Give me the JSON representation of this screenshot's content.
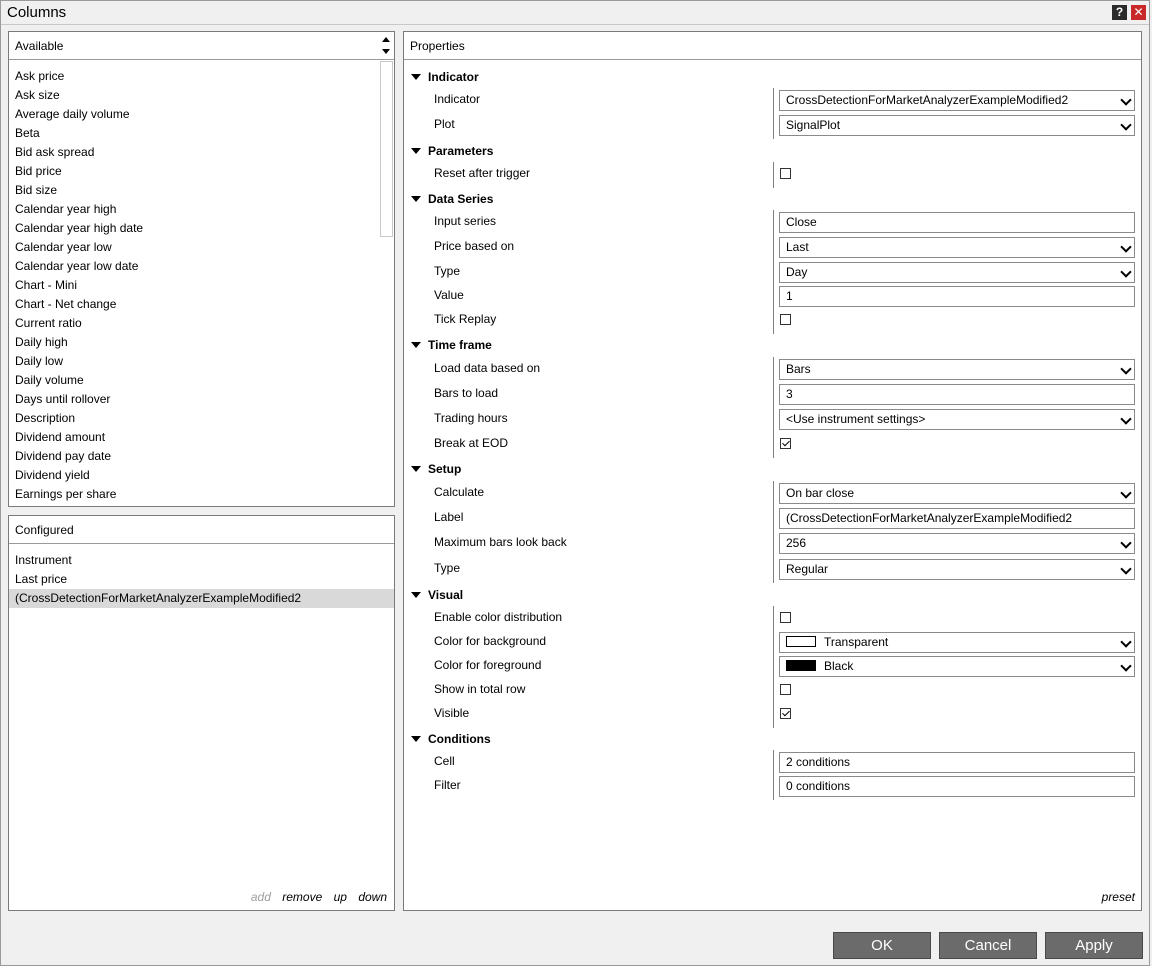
{
  "window": {
    "title": "Columns",
    "help_label": "?",
    "close_label": "✕"
  },
  "available": {
    "header": "Available",
    "items": [
      "Ask price",
      "Ask size",
      "Average daily volume",
      "Beta",
      "Bid ask spread",
      "Bid price",
      "Bid size",
      "Calendar year high",
      "Calendar year high date",
      "Calendar year low",
      "Calendar year low date",
      "Chart - Mini",
      "Chart - Net change",
      "Current ratio",
      "Daily high",
      "Daily low",
      "Daily volume",
      "Days until rollover",
      "Description",
      "Dividend amount",
      "Dividend pay date",
      "Dividend yield",
      "Earnings per share"
    ]
  },
  "configured": {
    "header": "Configured",
    "items": [
      "Instrument",
      "Last price",
      "(CrossDetectionForMarketAnalyzerExampleModified2"
    ],
    "selected_index": 2,
    "actions": {
      "add": "add",
      "remove": "remove",
      "up": "up",
      "down": "down"
    }
  },
  "properties": {
    "header": "Properties",
    "preset": "preset",
    "categories": {
      "indicator": "Indicator",
      "parameters": "Parameters",
      "data_series": "Data Series",
      "time_frame": "Time frame",
      "setup": "Setup",
      "visual": "Visual",
      "conditions": "Conditions"
    },
    "labels": {
      "indicator": "Indicator",
      "plot": "Plot",
      "reset_after_trigger": "Reset after trigger",
      "input_series": "Input series",
      "price_based_on": "Price based on",
      "type": "Type",
      "value": "Value",
      "tick_replay": "Tick Replay",
      "load_data_based_on": "Load data based on",
      "bars_to_load": "Bars to load",
      "trading_hours": "Trading hours",
      "break_at_eod": "Break at EOD",
      "calculate": "Calculate",
      "label": "Label",
      "max_bars_look_back": "Maximum bars look back",
      "setup_type": "Type",
      "enable_color_distribution": "Enable color distribution",
      "color_background": "Color for background",
      "color_foreground": "Color for foreground",
      "show_in_total_row": "Show in total row",
      "visible": "Visible",
      "cell": "Cell",
      "filter": "Filter"
    },
    "values": {
      "indicator": "CrossDetectionForMarketAnalyzerExampleModified2",
      "plot": "SignalPlot",
      "reset_after_trigger": false,
      "input_series": "Close",
      "price_based_on": "Last",
      "type": "Day",
      "value": "1",
      "tick_replay": false,
      "load_data_based_on": "Bars",
      "bars_to_load": "3",
      "trading_hours": "<Use instrument settings>",
      "break_at_eod": true,
      "calculate": "On bar close",
      "label": "(CrossDetectionForMarketAnalyzerExampleModified2",
      "max_bars_look_back": "256",
      "setup_type": "Regular",
      "enable_color_distribution": false,
      "color_background": "Transparent",
      "color_background_swatch": "#ffffff",
      "color_foreground": "Black",
      "color_foreground_swatch": "#000000",
      "show_in_total_row": false,
      "visible": true,
      "cell": "2 conditions",
      "filter": "0 conditions"
    }
  },
  "buttons": {
    "ok": "OK",
    "cancel": "Cancel",
    "apply": "Apply"
  }
}
